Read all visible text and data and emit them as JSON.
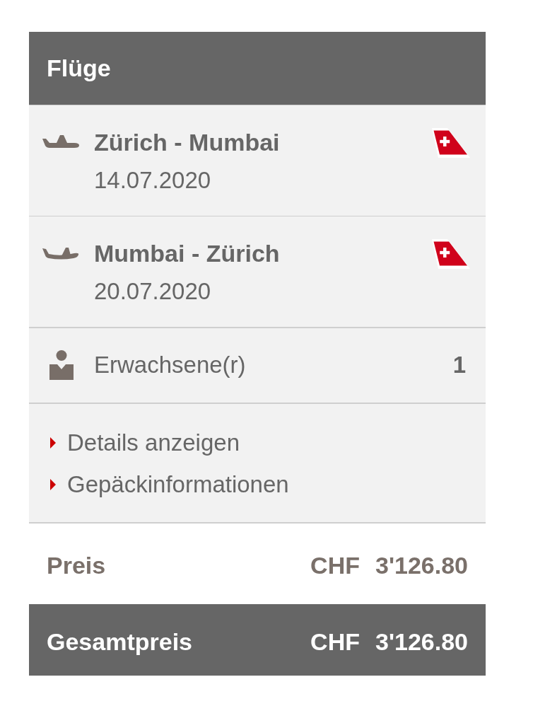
{
  "header": {
    "title": "Flüge"
  },
  "flights": [
    {
      "kind": "outbound",
      "route": "Zürich - Mumbai",
      "date": "14.07.2020"
    },
    {
      "kind": "inbound",
      "route": "Mumbai - Zürich",
      "date": "20.07.2020"
    }
  ],
  "passengers": [
    {
      "label": "Erwachsene(r)",
      "count": "1"
    }
  ],
  "links": [
    {
      "label": "Details anzeigen"
    },
    {
      "label": "Gepäckinformationen"
    }
  ],
  "price": {
    "label": "Preis",
    "currency": "CHF",
    "amount": "3'126.80"
  },
  "total": {
    "label": "Gesamtpreis",
    "currency": "CHF",
    "amount": "3'126.80"
  }
}
